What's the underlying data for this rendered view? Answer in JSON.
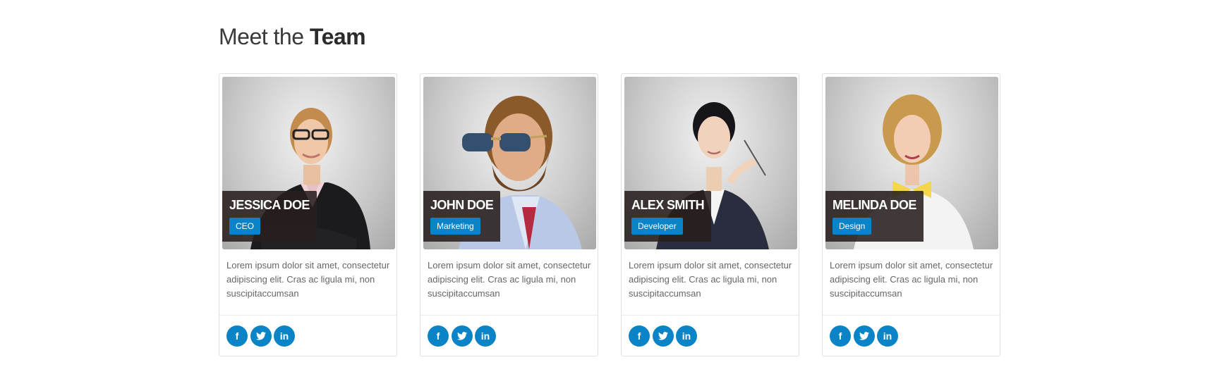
{
  "heading": {
    "light": "Meet the",
    "bold": "Team"
  },
  "team": [
    {
      "name": "JESSICA DOE",
      "role": "CEO",
      "description": "Lorem ipsum dolor sit amet, consectetur adipiscing elit. Cras ac ligula mi, non suscipitaccumsan"
    },
    {
      "name": "JOHN DOE",
      "role": "Marketing",
      "description": "Lorem ipsum dolor sit amet, consectetur adipiscing elit. Cras ac ligula mi, non suscipitaccumsan"
    },
    {
      "name": "ALEX SMITH",
      "role": "Developer",
      "description": "Lorem ipsum dolor sit amet, consectetur adipiscing elit. Cras ac ligula mi, non suscipitaccumsan"
    },
    {
      "name": "MELINDA DOE",
      "role": "Design",
      "description": "Lorem ipsum dolor sit amet, consectetur adipiscing elit. Cras ac ligula mi, non suscipitaccumsan"
    }
  ],
  "social_icons": {
    "facebook": "f",
    "twitter": "facebook-twitter-bird",
    "linkedin": "in"
  },
  "colors": {
    "accent": "#0a84c6",
    "caption_bg": "#2c2020",
    "text": "#666666",
    "heading": "#333333"
  }
}
